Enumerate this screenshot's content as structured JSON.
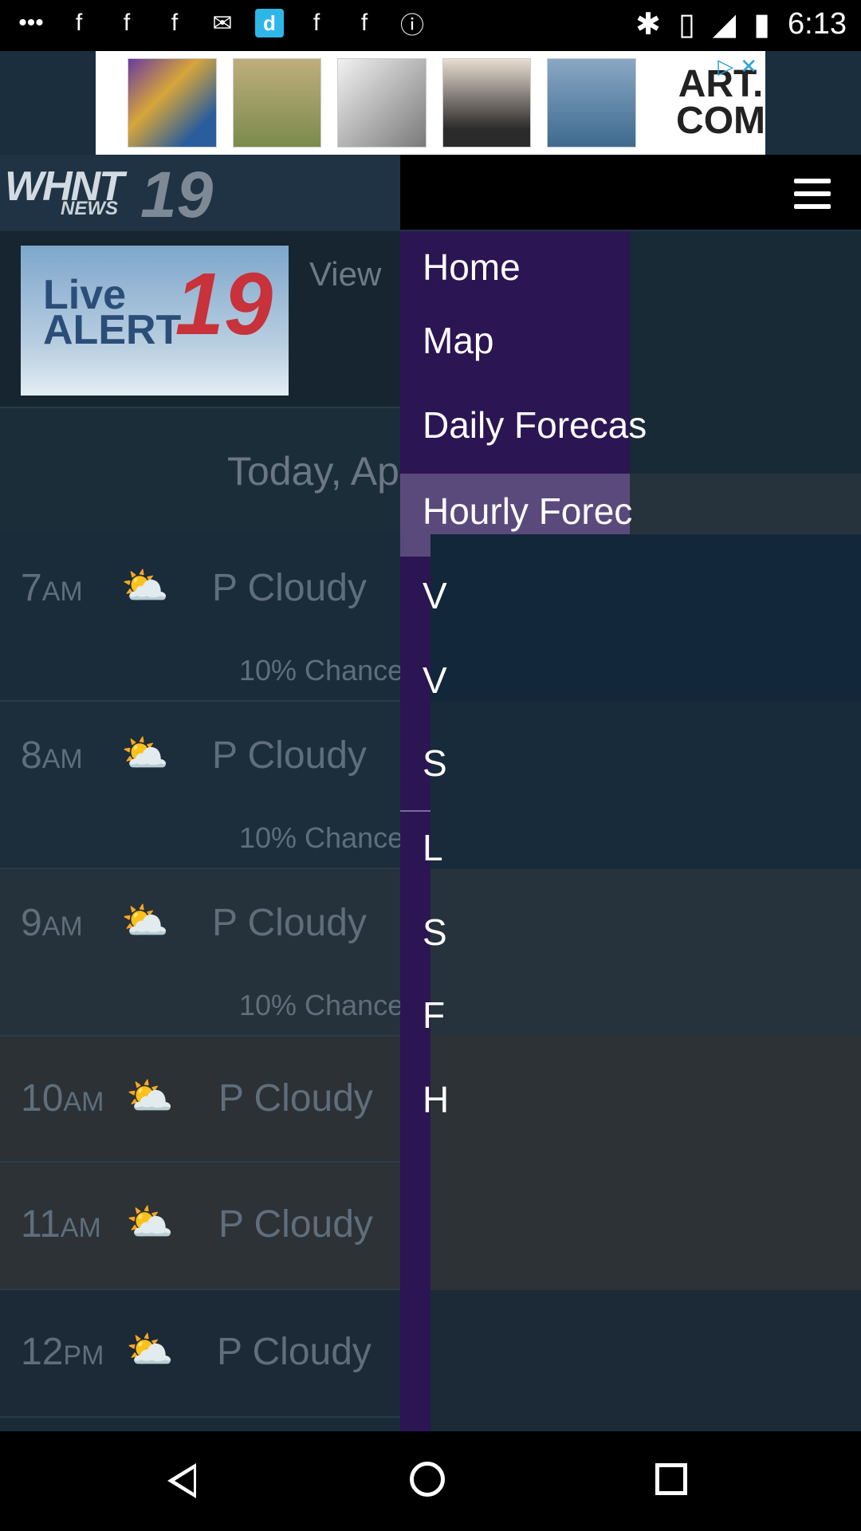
{
  "status_bar": {
    "time": "6:13"
  },
  "ad": {
    "brand_text": "ART.\nCOM"
  },
  "header": {
    "logo_main": "WHNT",
    "logo_sub": "NEWS",
    "logo_number": "19"
  },
  "live_alert": {
    "thumb_text": "Live\nALERT",
    "thumb_number": "19",
    "view_label": "View"
  },
  "today_label": "Today, Ap",
  "hours": [
    {
      "time": "7",
      "ampm": "AM",
      "condition": "P Cloudy",
      "chance": "10% Chance"
    },
    {
      "time": "8",
      "ampm": "AM",
      "condition": "P Cloudy",
      "chance": "10% Chance"
    },
    {
      "time": "9",
      "ampm": "AM",
      "condition": "P Cloudy",
      "chance": "10% Chance"
    },
    {
      "time": "10",
      "ampm": "AM",
      "condition": "P Cloudy"
    },
    {
      "time": "11",
      "ampm": "AM",
      "condition": "P Cloudy"
    },
    {
      "time": "12",
      "ampm": "PM",
      "condition": "P Cloudy"
    }
  ],
  "menu": {
    "items": [
      {
        "label": "Home"
      },
      {
        "label": "Map"
      },
      {
        "label": "Daily Forecas"
      },
      {
        "label": "Hourly Forec"
      }
    ],
    "truncated_letters": [
      "V",
      "V",
      "S",
      "L",
      "S",
      "F",
      "H"
    ]
  }
}
